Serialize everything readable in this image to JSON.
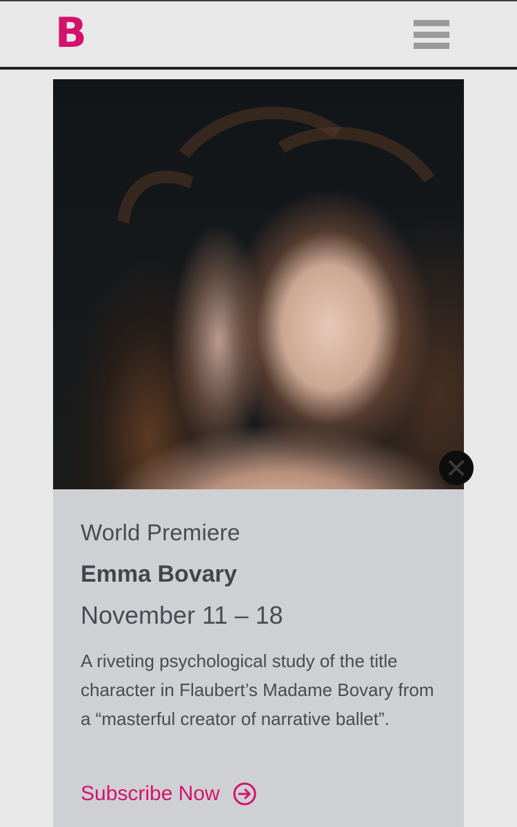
{
  "header": {
    "logo_text": "B",
    "menu_icon": "hamburger-menu-icon"
  },
  "hero": {
    "close_icon": "close-icon"
  },
  "event": {
    "eyebrow": "World Premiere",
    "title": "Emma Bovary",
    "dates": "November 11 – 18",
    "description": "A riveting psychological study of the title character in Flaubert’s Madame Bovary from a “masterful creator of narrative ballet”.",
    "cta_label": "Subscribe Now",
    "cta_icon": "arrow-right-circle-icon"
  },
  "colors": {
    "brand": "#d3126e",
    "card_bg": "#cfd0d3",
    "page_bg": "#e8e8e8"
  }
}
